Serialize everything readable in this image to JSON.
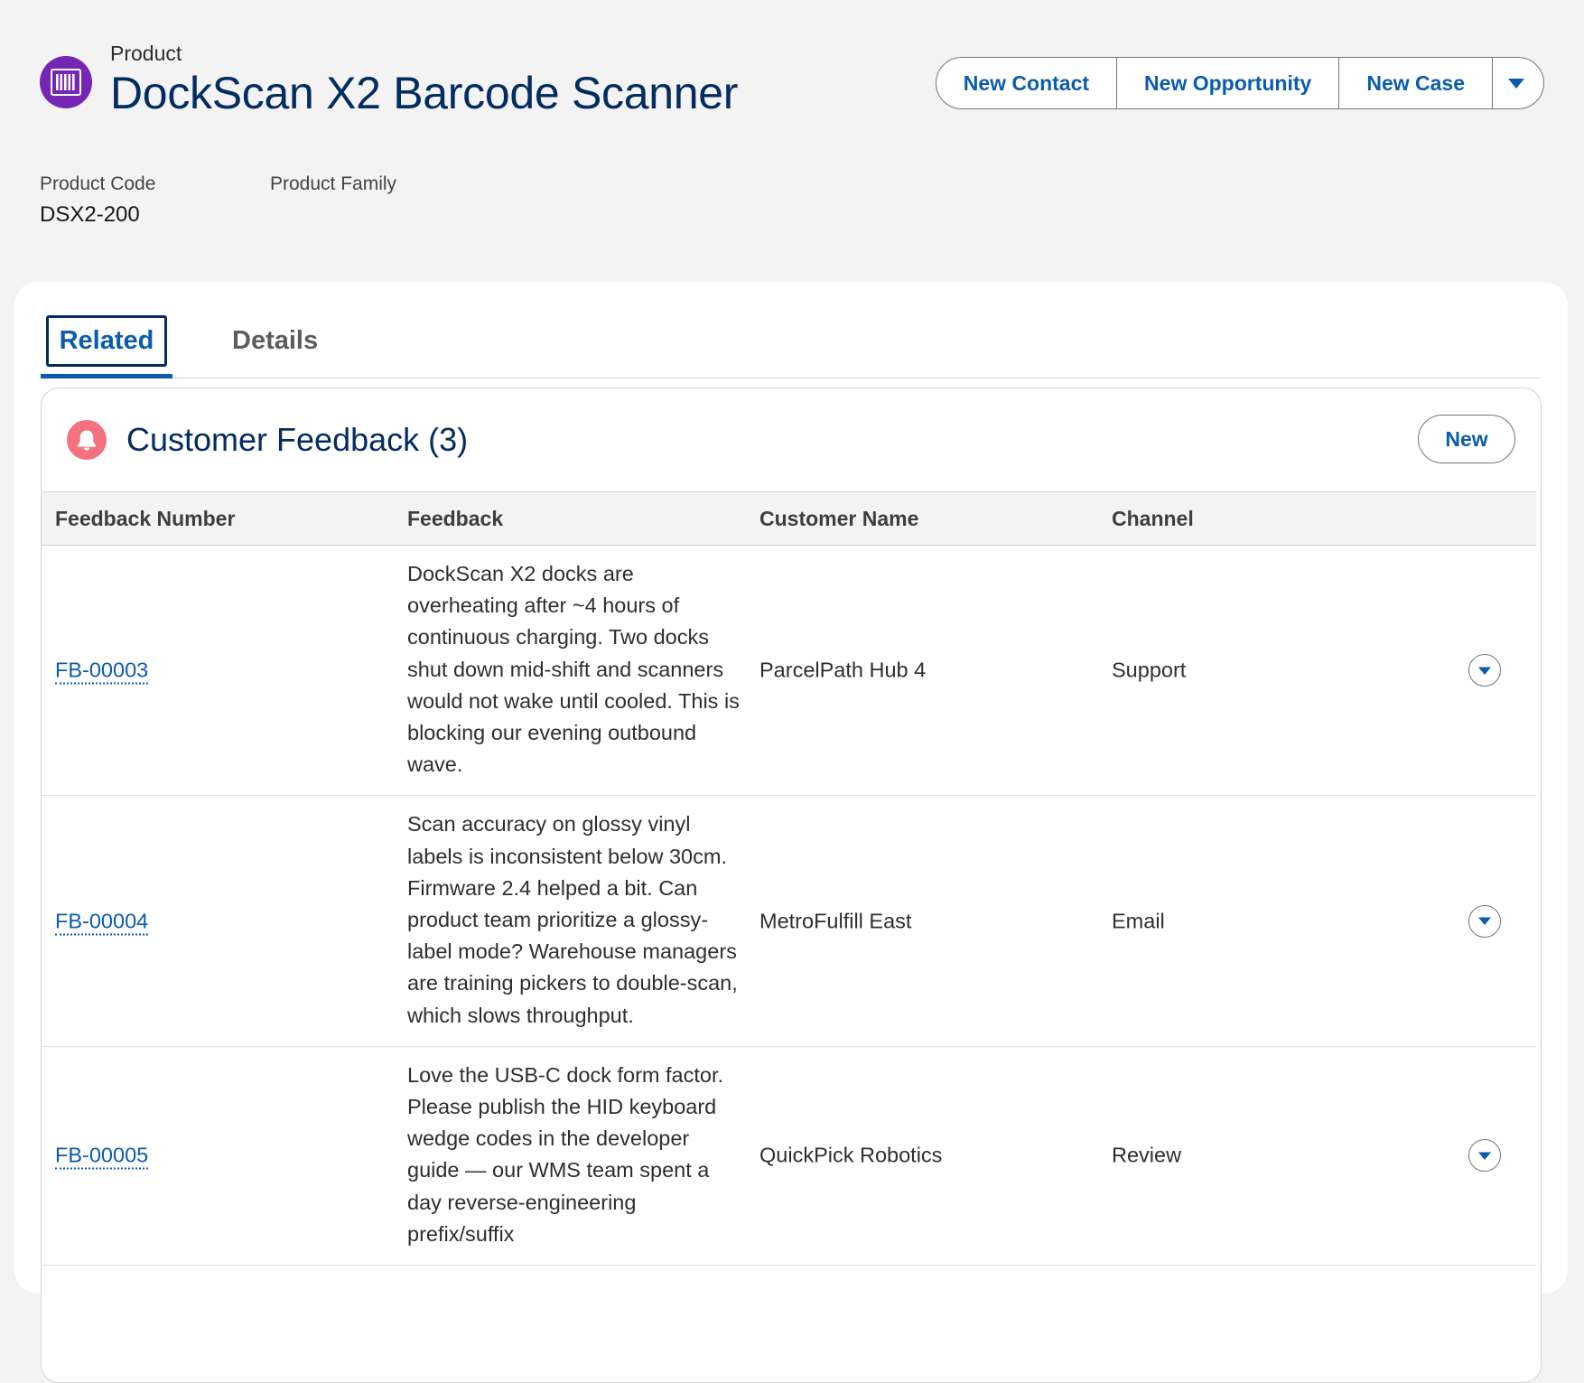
{
  "record": {
    "object_type": "Product",
    "title": "DockScan X2 Barcode Scanner",
    "icon": "product-barcode-icon"
  },
  "actions": {
    "new_contact": "New Contact",
    "new_opportunity": "New Opportunity",
    "new_case": "New Case",
    "more_icon": "chevron-down-icon"
  },
  "highlights": {
    "product_code_label": "Product Code",
    "product_code_value": "DSX2-200",
    "product_family_label": "Product Family",
    "product_family_value": ""
  },
  "tabs": [
    {
      "label": "Related",
      "active": true
    },
    {
      "label": "Details",
      "active": false
    }
  ],
  "related_list": {
    "title": "Customer Feedback (3)",
    "icon": "bell-icon",
    "new_label": "New",
    "columns": [
      "Feedback Number",
      "Feedback",
      "Customer Name",
      "Channel"
    ],
    "rows": [
      {
        "number": "FB-00003",
        "feedback": "DockScan X2 docks are overheating after ~4 hours of continuous charging. Two docks shut down mid-shift and scanners would not wake until cooled. This is blocking our evening outbound wave.",
        "customer": "ParcelPath Hub 4",
        "channel": "Support"
      },
      {
        "number": "FB-00004",
        "feedback": "Scan accuracy on glossy vinyl labels is inconsistent below 30cm. Firmware 2.4 helped a bit. Can product team prioritize a glossy-label mode? Warehouse managers are training pickers to double-scan, which slows throughput.",
        "customer": "MetroFulfill East",
        "channel": "Email"
      },
      {
        "number": "FB-00005",
        "feedback": "Love the USB-C dock form factor. Please publish the HID keyboard wedge codes in the developer guide — our WMS team spent a day reverse-engineering prefix/suffix",
        "customer": "QuickPick Robotics",
        "channel": "Review"
      }
    ]
  },
  "colors": {
    "brand_blue": "#0b5cab",
    "title_navy": "#032d60",
    "product_icon_bg": "#7526b5",
    "feedback_icon_bg": "#f4717f"
  }
}
